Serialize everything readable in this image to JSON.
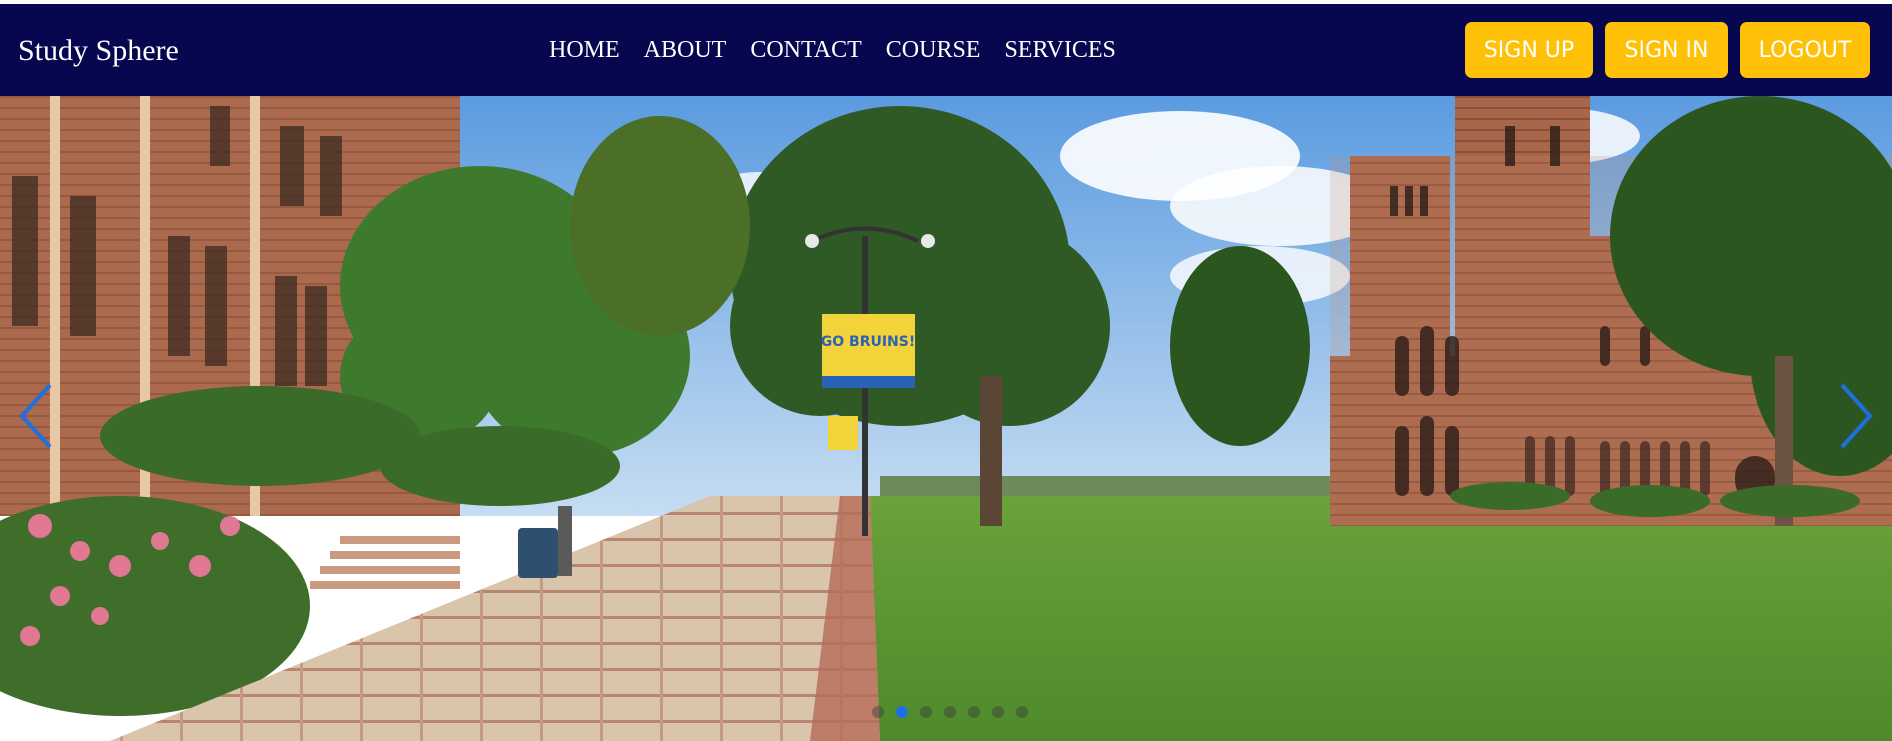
{
  "brand": {
    "name": "Study Sphere"
  },
  "nav": {
    "items": [
      {
        "label": "HOME"
      },
      {
        "label": "ABOUT"
      },
      {
        "label": "CONTACT"
      },
      {
        "label": "COURSE"
      },
      {
        "label": "SERVICES"
      }
    ]
  },
  "auth": {
    "signup_label": "SIGN UP",
    "signin_label": "SIGN IN",
    "logout_label": "LOGOUT"
  },
  "banner": {
    "sign_text": "GO BRUINS!"
  },
  "carousel": {
    "slide_count": 7,
    "active_index": 1,
    "prev_icon": "chevron-left-icon",
    "next_icon": "chevron-right-icon"
  },
  "colors": {
    "navbar": "#06074f",
    "button": "#ffc107",
    "accent": "#1e6fe0"
  }
}
